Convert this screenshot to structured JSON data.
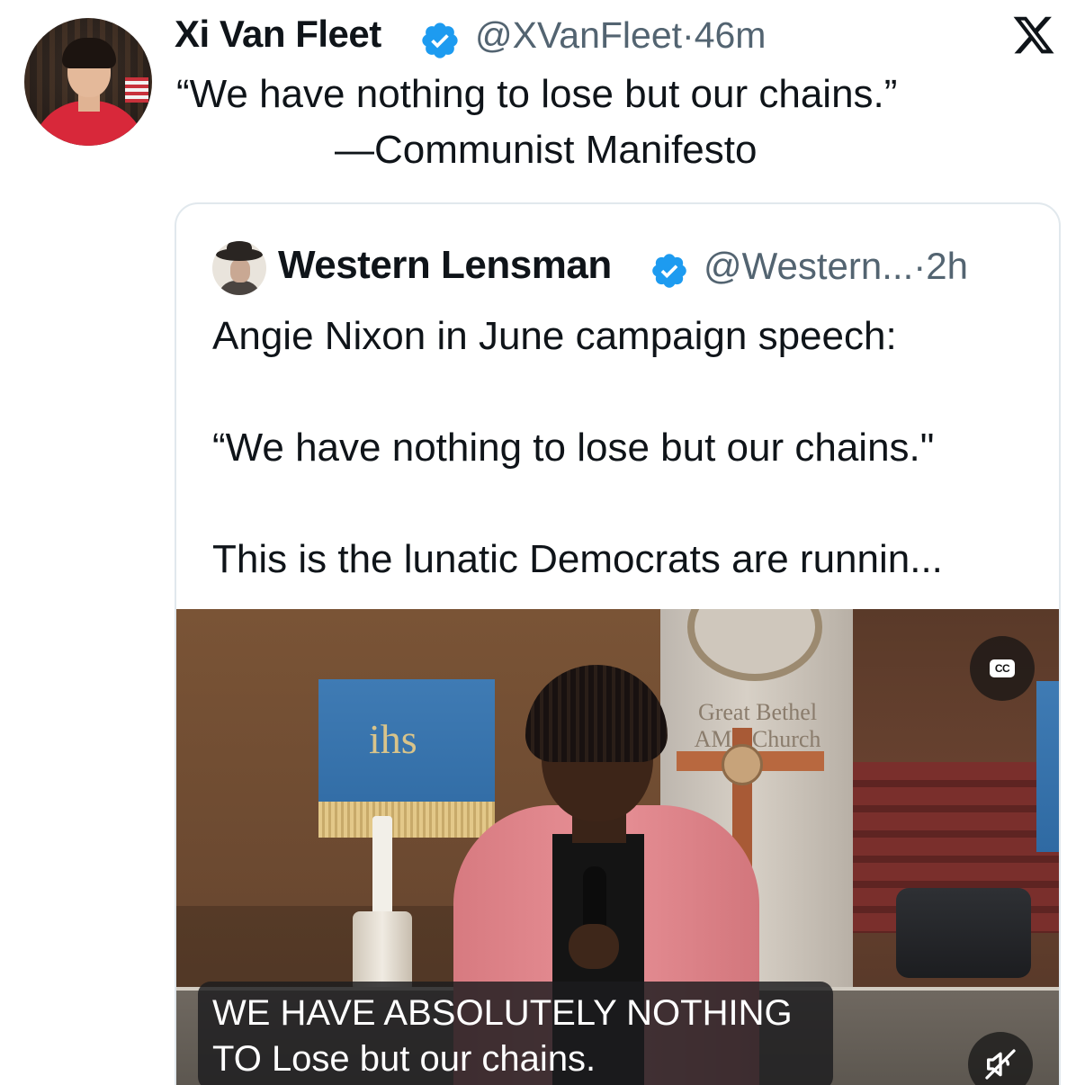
{
  "outer_tweet": {
    "author_name": "Xi Van Fleet",
    "author_handle": "@XVanFleet",
    "separator": "·",
    "time": "46m",
    "text_line1": "“We have nothing to lose but our chains.”",
    "text_line2": "—Communist Manifesto"
  },
  "platform": {
    "logo": "x-logo-icon"
  },
  "quoted_tweet": {
    "author_name": "Western Lensman",
    "author_handle": "@Western...",
    "separator": "·",
    "time": "2h",
    "text_line1": "Angie Nixon in June campaign speech:",
    "text_line2": "“We have nothing to lose but our chains.\"",
    "text_line3": "This is the lunatic Democrats are runnin...",
    "video": {
      "pillar_text_line1": "Great Bethel",
      "pillar_text_line2": "AME Church",
      "drape_symbol": "ihs",
      "caption_line1": "WE HAVE ABSOLUTELY NOTHING",
      "caption_line2": "TO Lose but our chains.",
      "cc_label": "CC",
      "controls": [
        "cc-icon",
        "muted-speaker-icon"
      ]
    }
  },
  "colors": {
    "text_primary": "#0f1419",
    "text_secondary": "#536471",
    "verified_blue": "#1d9bf0",
    "card_border": "#e1e8ed"
  }
}
